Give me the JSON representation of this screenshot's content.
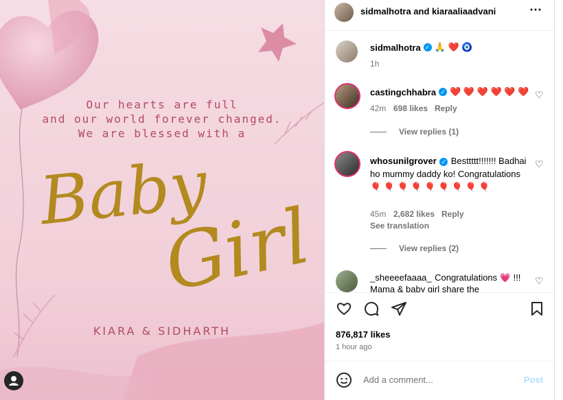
{
  "colors": {
    "accent": "#0095f6",
    "post_bg": "#f3d4dd",
    "gold": "#b28a1f",
    "rose": "#b24a66"
  },
  "post": {
    "line1": "Our hearts are full",
    "line2": "and our world forever changed.",
    "line3": "We are blessed with a",
    "script1": "Baby",
    "script2": "Girl",
    "names": "KIARA & SIDHARTH"
  },
  "header": {
    "authors": "sidmalhotra and kiaraaliaadvani",
    "more_icon": "more-icon"
  },
  "caption": {
    "user": "sidmalhotra",
    "text": "🙏 ❤️ 🧿",
    "time": "1h"
  },
  "comments": [
    {
      "user": "castingchhabra",
      "text": "❤️ ❤️ ❤️ ❤️ ❤️ ❤️",
      "time": "42m",
      "likes": "698 likes",
      "reply": "Reply",
      "view_replies": "View replies (1)"
    },
    {
      "user": "whosunilgrover",
      "text": "Besttttt!!!!!!! Badhai ho mummy daddy ko! Congratulations 🎈 🎈 🎈 🎈 🎈 🎈 🎈 🎈 🎈",
      "time": "45m",
      "likes": "2,682 likes",
      "reply": "Reply",
      "see_translation": "See translation",
      "view_replies": "View replies (2)"
    },
    {
      "user": "_sheeeefaaaa_",
      "text": "Congratulations 💗 !!! Mama & baby girl share the"
    }
  ],
  "actions": {
    "likes": "876,817 likes",
    "time": "1 hour ago"
  },
  "composer": {
    "placeholder": "Add a comment...",
    "post": "Post"
  }
}
